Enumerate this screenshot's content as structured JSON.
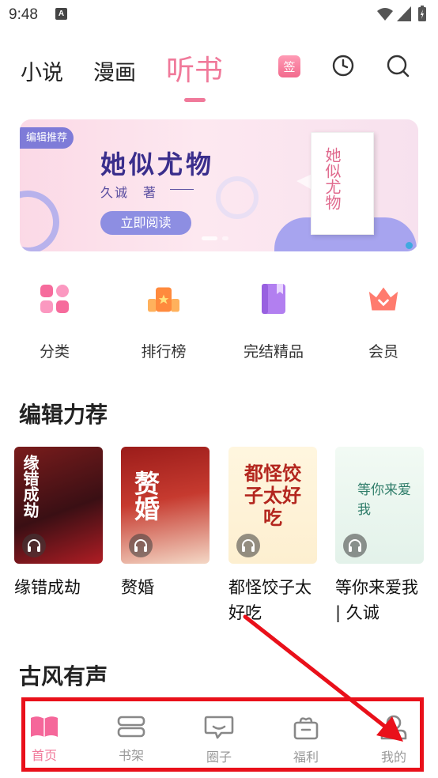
{
  "status_bar": {
    "time": "9:48",
    "notif_glyph": "A"
  },
  "top_tabs": [
    {
      "label": "小说",
      "active": false
    },
    {
      "label": "漫画",
      "active": false
    },
    {
      "label": "听书",
      "active": true
    }
  ],
  "header_icons": {
    "checkin_label": "签",
    "history": "clock-icon",
    "search": "search-icon"
  },
  "banner": {
    "badge": "编辑推荐",
    "title": "她似尤物",
    "author": "久诚　著",
    "button": "立即阅读",
    "cover_text": "她似尤物"
  },
  "quick_links": [
    {
      "label": "分类",
      "icon": "category-icon"
    },
    {
      "label": "排行榜",
      "icon": "ranking-icon"
    },
    {
      "label": "完结精品",
      "icon": "book-icon"
    },
    {
      "label": "会员",
      "icon": "crown-icon"
    }
  ],
  "sections": {
    "recommend": "编辑力荐",
    "classic": "古风有声"
  },
  "books": [
    {
      "title": "缘错成劫",
      "cover_text": "缘错成劫"
    },
    {
      "title": "赘婚",
      "cover_text": "赘婚"
    },
    {
      "title": "都怪饺子太好吃",
      "cover_text": "都怪饺子太好吃"
    },
    {
      "title": "等你来爱我 | 久诚",
      "cover_text": "等你来爱我"
    }
  ],
  "bottom_nav": [
    {
      "label": "首页",
      "active": true
    },
    {
      "label": "书架",
      "active": false
    },
    {
      "label": "圈子",
      "active": false
    },
    {
      "label": "福利",
      "active": false
    },
    {
      "label": "我的",
      "active": false
    }
  ],
  "colors": {
    "accent": "#f0799a",
    "banner_purple": "#7e7bd8",
    "annotation_red": "#e9101a"
  }
}
